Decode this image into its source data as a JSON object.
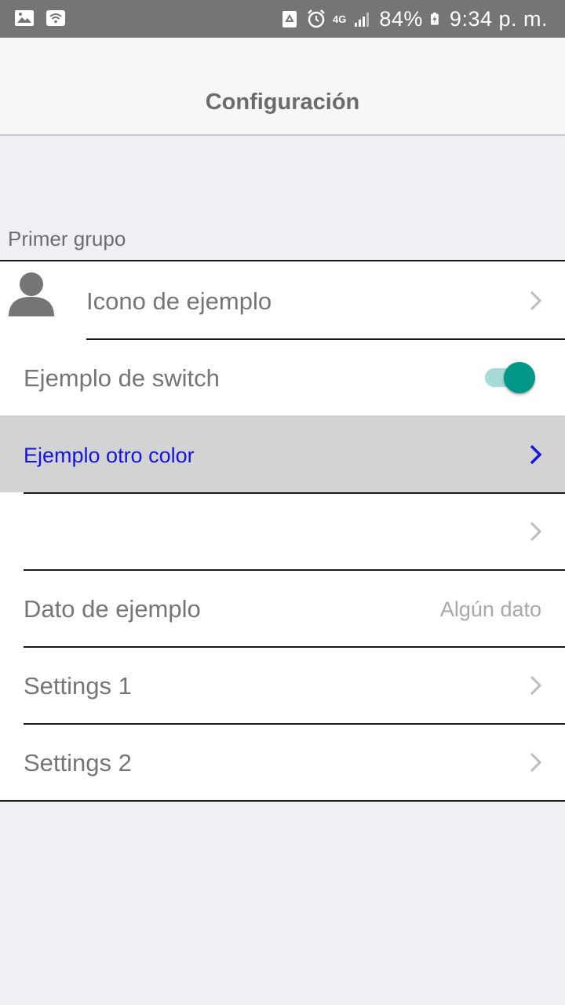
{
  "status_bar": {
    "battery_percent": "84%",
    "time": "9:34 p. m.",
    "network": "4G",
    "icons": [
      "gallery-icon",
      "wifi-icon",
      "recycle-icon",
      "alarm-icon",
      "signal-icon",
      "battery-charging-icon"
    ]
  },
  "header": {
    "title": "Configuración"
  },
  "group": {
    "title": "Primer grupo",
    "items": [
      {
        "label": "Icono de ejemplo",
        "accessory": "chevron",
        "icon": "user-icon"
      },
      {
        "label": "Ejemplo de switch",
        "accessory": "switch",
        "switch_on": true
      },
      {
        "label": "Ejemplo otro color",
        "accessory": "chevron",
        "selected": true
      },
      {
        "label": "",
        "accessory": "chevron"
      },
      {
        "label": "Dato de ejemplo",
        "detail": "Algún dato"
      },
      {
        "label": "Settings 1",
        "accessory": "chevron"
      },
      {
        "label": "Settings 2",
        "accessory": "chevron"
      }
    ]
  },
  "colors": {
    "status_bar": "#757575",
    "background": "#efeff4",
    "selected_row": "#d3d3d3",
    "accent_text": "#1414e6",
    "switch_on": "#009688"
  }
}
